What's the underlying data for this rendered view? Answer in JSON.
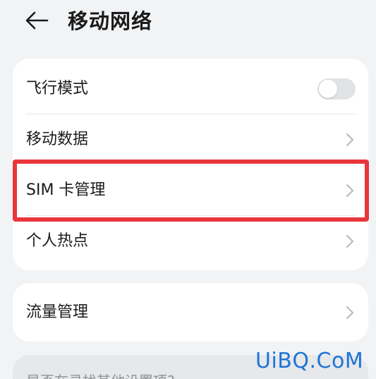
{
  "header": {
    "back_icon": "arrow-left-icon",
    "title": "移动网络"
  },
  "card1": {
    "rows": [
      {
        "label": "飞行模式",
        "control": "toggle",
        "toggle_on": false
      },
      {
        "label": "移动数据",
        "control": "chevron-right-icon"
      },
      {
        "label": "SIM 卡管理",
        "control": "chevron-right-icon",
        "highlighted": true
      },
      {
        "label": "个人热点",
        "control": "chevron-right-icon"
      }
    ]
  },
  "card2": {
    "rows": [
      {
        "label": "流量管理",
        "control": "chevron-right-icon"
      }
    ]
  },
  "card3": {
    "label": "是否在寻找其他设置项?"
  },
  "watermark": "UiBQ.CoM",
  "colors": {
    "background": "#f1f3f5",
    "card": "#ffffff",
    "highlight": "#e8363b",
    "toggle_off": "#e2e3e5",
    "watermark": "#1e74d6",
    "hint_text": "#8f9296"
  }
}
